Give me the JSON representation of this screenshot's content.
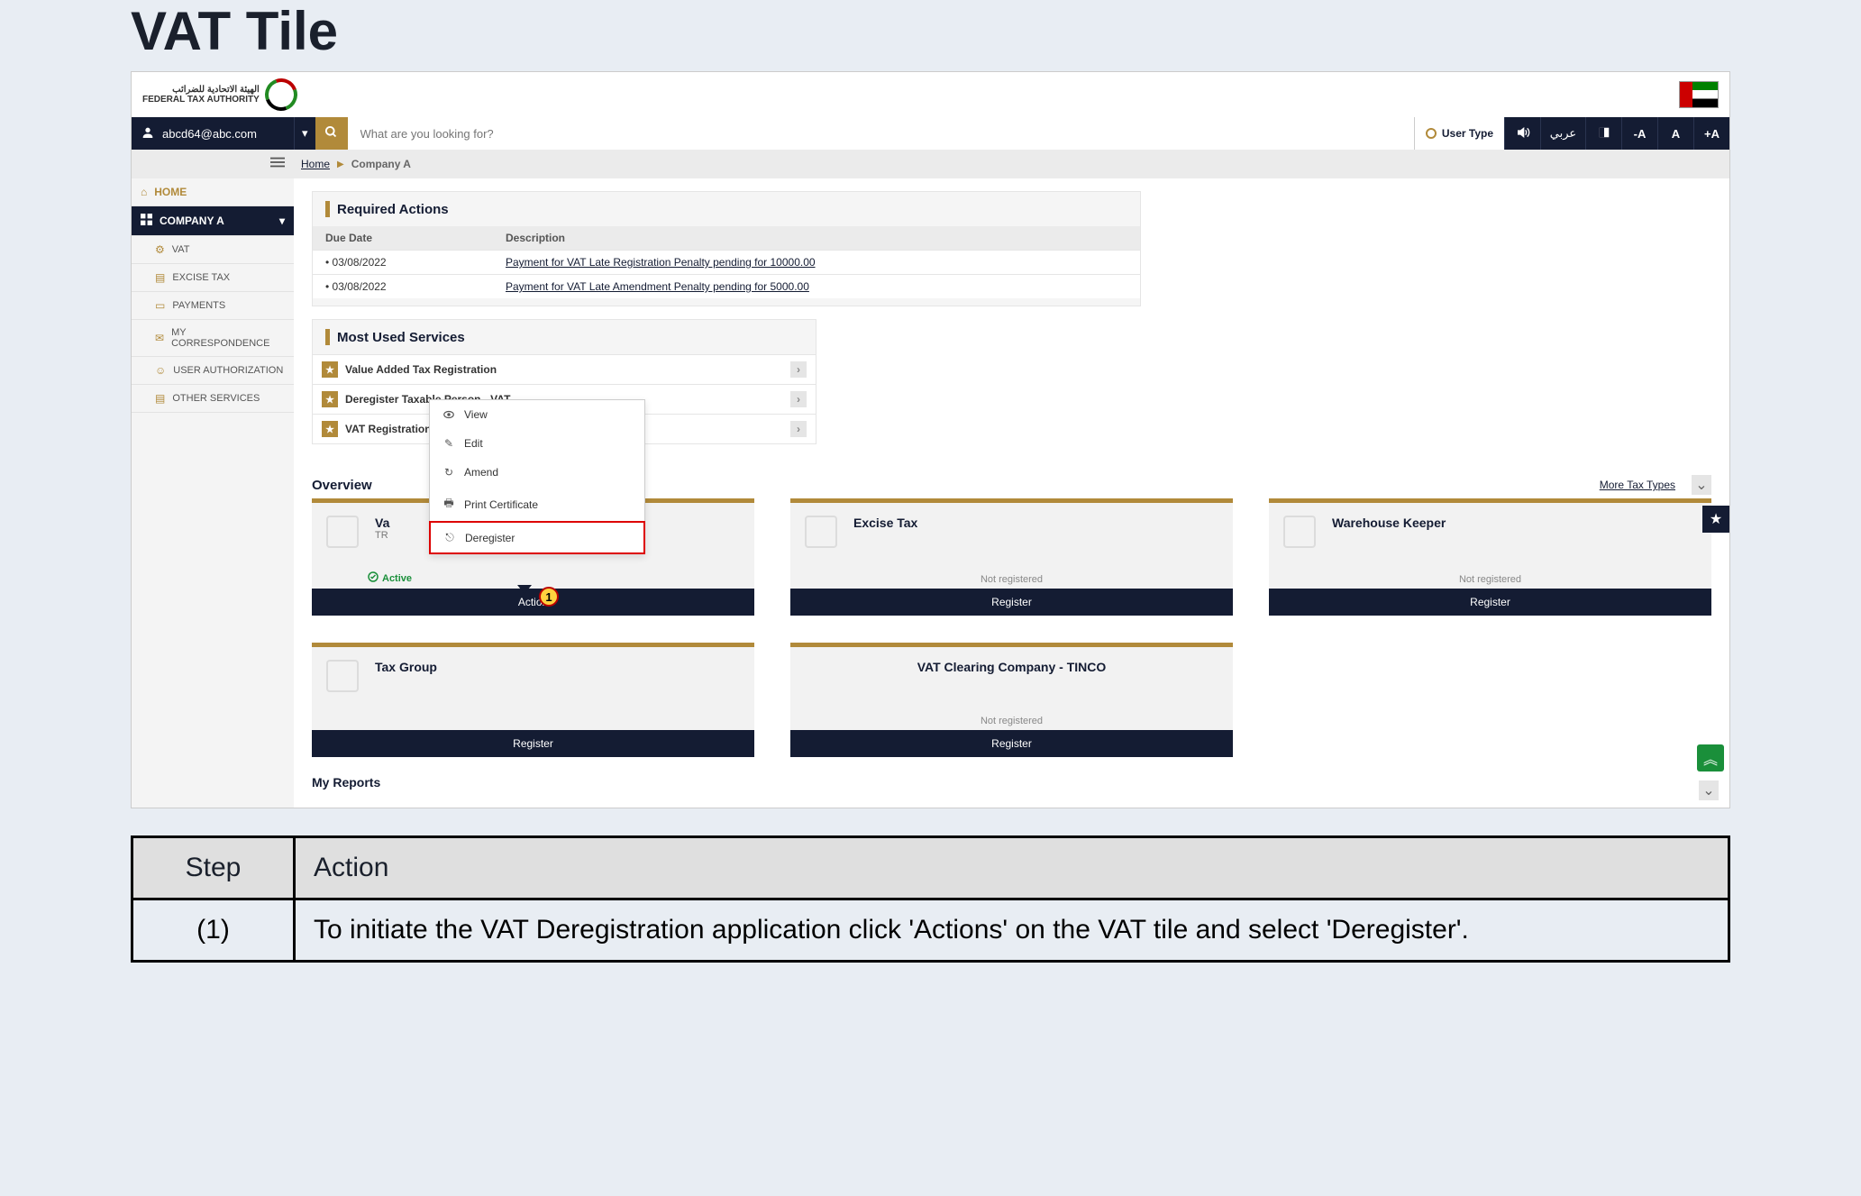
{
  "page_heading": "VAT Tile",
  "logo": {
    "line1": "الهيئة الاتحادية للضرائب",
    "line2": "FEDERAL TAX AUTHORITY"
  },
  "header": {
    "account": "abcd64@abc.com",
    "search_placeholder": "What are you looking for?",
    "user_type": "User Type",
    "lang": "عربي",
    "fs_minus": "-A",
    "fs_normal": "A",
    "fs_plus": "+A"
  },
  "breadcrumb": {
    "home": "Home",
    "current": "Company A"
  },
  "sidebar": {
    "home": "HOME",
    "company": "COMPANY A",
    "items": [
      {
        "label": "VAT"
      },
      {
        "label": "EXCISE TAX"
      },
      {
        "label": "PAYMENTS"
      },
      {
        "label": "MY CORRESPONDENCE"
      },
      {
        "label": "USER AUTHORIZATION"
      },
      {
        "label": "OTHER SERVICES"
      }
    ]
  },
  "required": {
    "title": "Required Actions",
    "col1": "Due Date",
    "col2": "Description",
    "rows": [
      {
        "date": "• 03/08/2022",
        "desc": "Payment for VAT Late Registration Penalty pending for 10000.00"
      },
      {
        "date": "• 03/08/2022",
        "desc": "Payment for VAT Late Amendment Penalty pending for 5000.00"
      }
    ]
  },
  "most_used": {
    "title": "Most Used Services",
    "items": [
      "Value Added Tax Registration",
      "Deregister Taxable Person - VAT",
      "VAT Registration – Amend Application"
    ]
  },
  "dropdown": {
    "items": [
      {
        "label": "View"
      },
      {
        "label": "Edit"
      },
      {
        "label": "Amend"
      },
      {
        "label": "Print Certificate"
      },
      {
        "label": "Deregister"
      }
    ]
  },
  "overview": {
    "title": "Overview",
    "more": "More Tax Types",
    "tiles_row1": [
      {
        "title": "Va",
        "trn_label": "TR",
        "status": "Active",
        "footer": "Action",
        "registered": true
      },
      {
        "title": "Excise Tax",
        "status": "Not registered",
        "footer": "Register",
        "registered": false
      },
      {
        "title": "Warehouse Keeper",
        "status": "Not registered",
        "footer": "Register",
        "registered": false
      }
    ],
    "tiles_row2": [
      {
        "title": "Tax Group",
        "status": "",
        "footer": "Register",
        "registered": false
      },
      {
        "title": "VAT Clearing Company - TINCO",
        "status": "Not registered",
        "footer": "Register",
        "registered": false
      }
    ]
  },
  "callout_badge": "1",
  "reports_title": "My Reports",
  "step_table": {
    "head_step": "Step",
    "head_action": "Action",
    "rows": [
      {
        "step": "(1)",
        "action": "To initiate the VAT Deregistration application click 'Actions' on the VAT tile and select 'Deregister'."
      }
    ]
  }
}
